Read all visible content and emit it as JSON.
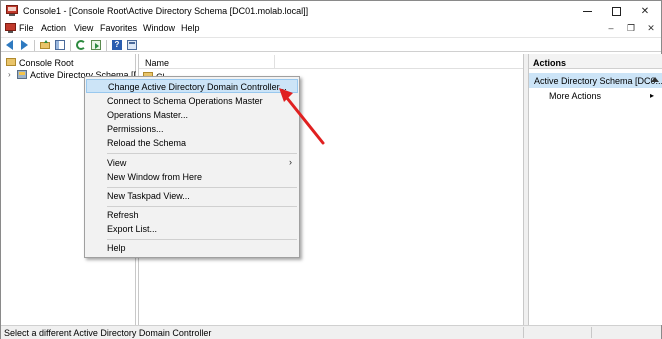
{
  "window": {
    "title": "Console1 - [Console Root\\Active Directory Schema [DC01.molab.local]]",
    "minimize_glyph": "–",
    "maximize_glyph": "□",
    "close_glyph": "✕"
  },
  "menubar": {
    "items": [
      "File",
      "Action",
      "View",
      "Favorites",
      "Window",
      "Help"
    ],
    "right_min": "–",
    "right_restore": "❐",
    "right_close": "✕"
  },
  "tree": {
    "root_label": "Console Root",
    "child_label": "Active Directory Schema [DC01",
    "child_expander": "›"
  },
  "content": {
    "column_name": "Name",
    "partial_row": "Cl"
  },
  "actions": {
    "header": "Actions",
    "section_label": "Active Directory Schema [DC0...",
    "more_label": "More Actions",
    "more_arrow": "▸"
  },
  "context_menu": {
    "items": [
      {
        "label": "Change Active Directory Domain Controller...",
        "highlighted": true
      },
      {
        "label": "Connect to Schema Operations Master"
      },
      {
        "label": "Operations Master..."
      },
      {
        "label": "Permissions..."
      },
      {
        "label": "Reload the Schema"
      },
      {
        "label": "View",
        "submenu": "›"
      },
      {
        "label": "New Window from Here"
      },
      {
        "label": "New Taskpad View..."
      },
      {
        "label": "Refresh"
      },
      {
        "label": "Export List..."
      },
      {
        "label": "Help"
      }
    ]
  },
  "statusbar": {
    "text": "Select a different Active Directory Domain Controller"
  },
  "colors": {
    "highlight": "#cce4f7",
    "annotation_arrow": "#e02020",
    "menu_bg": "#f2f2f2"
  }
}
